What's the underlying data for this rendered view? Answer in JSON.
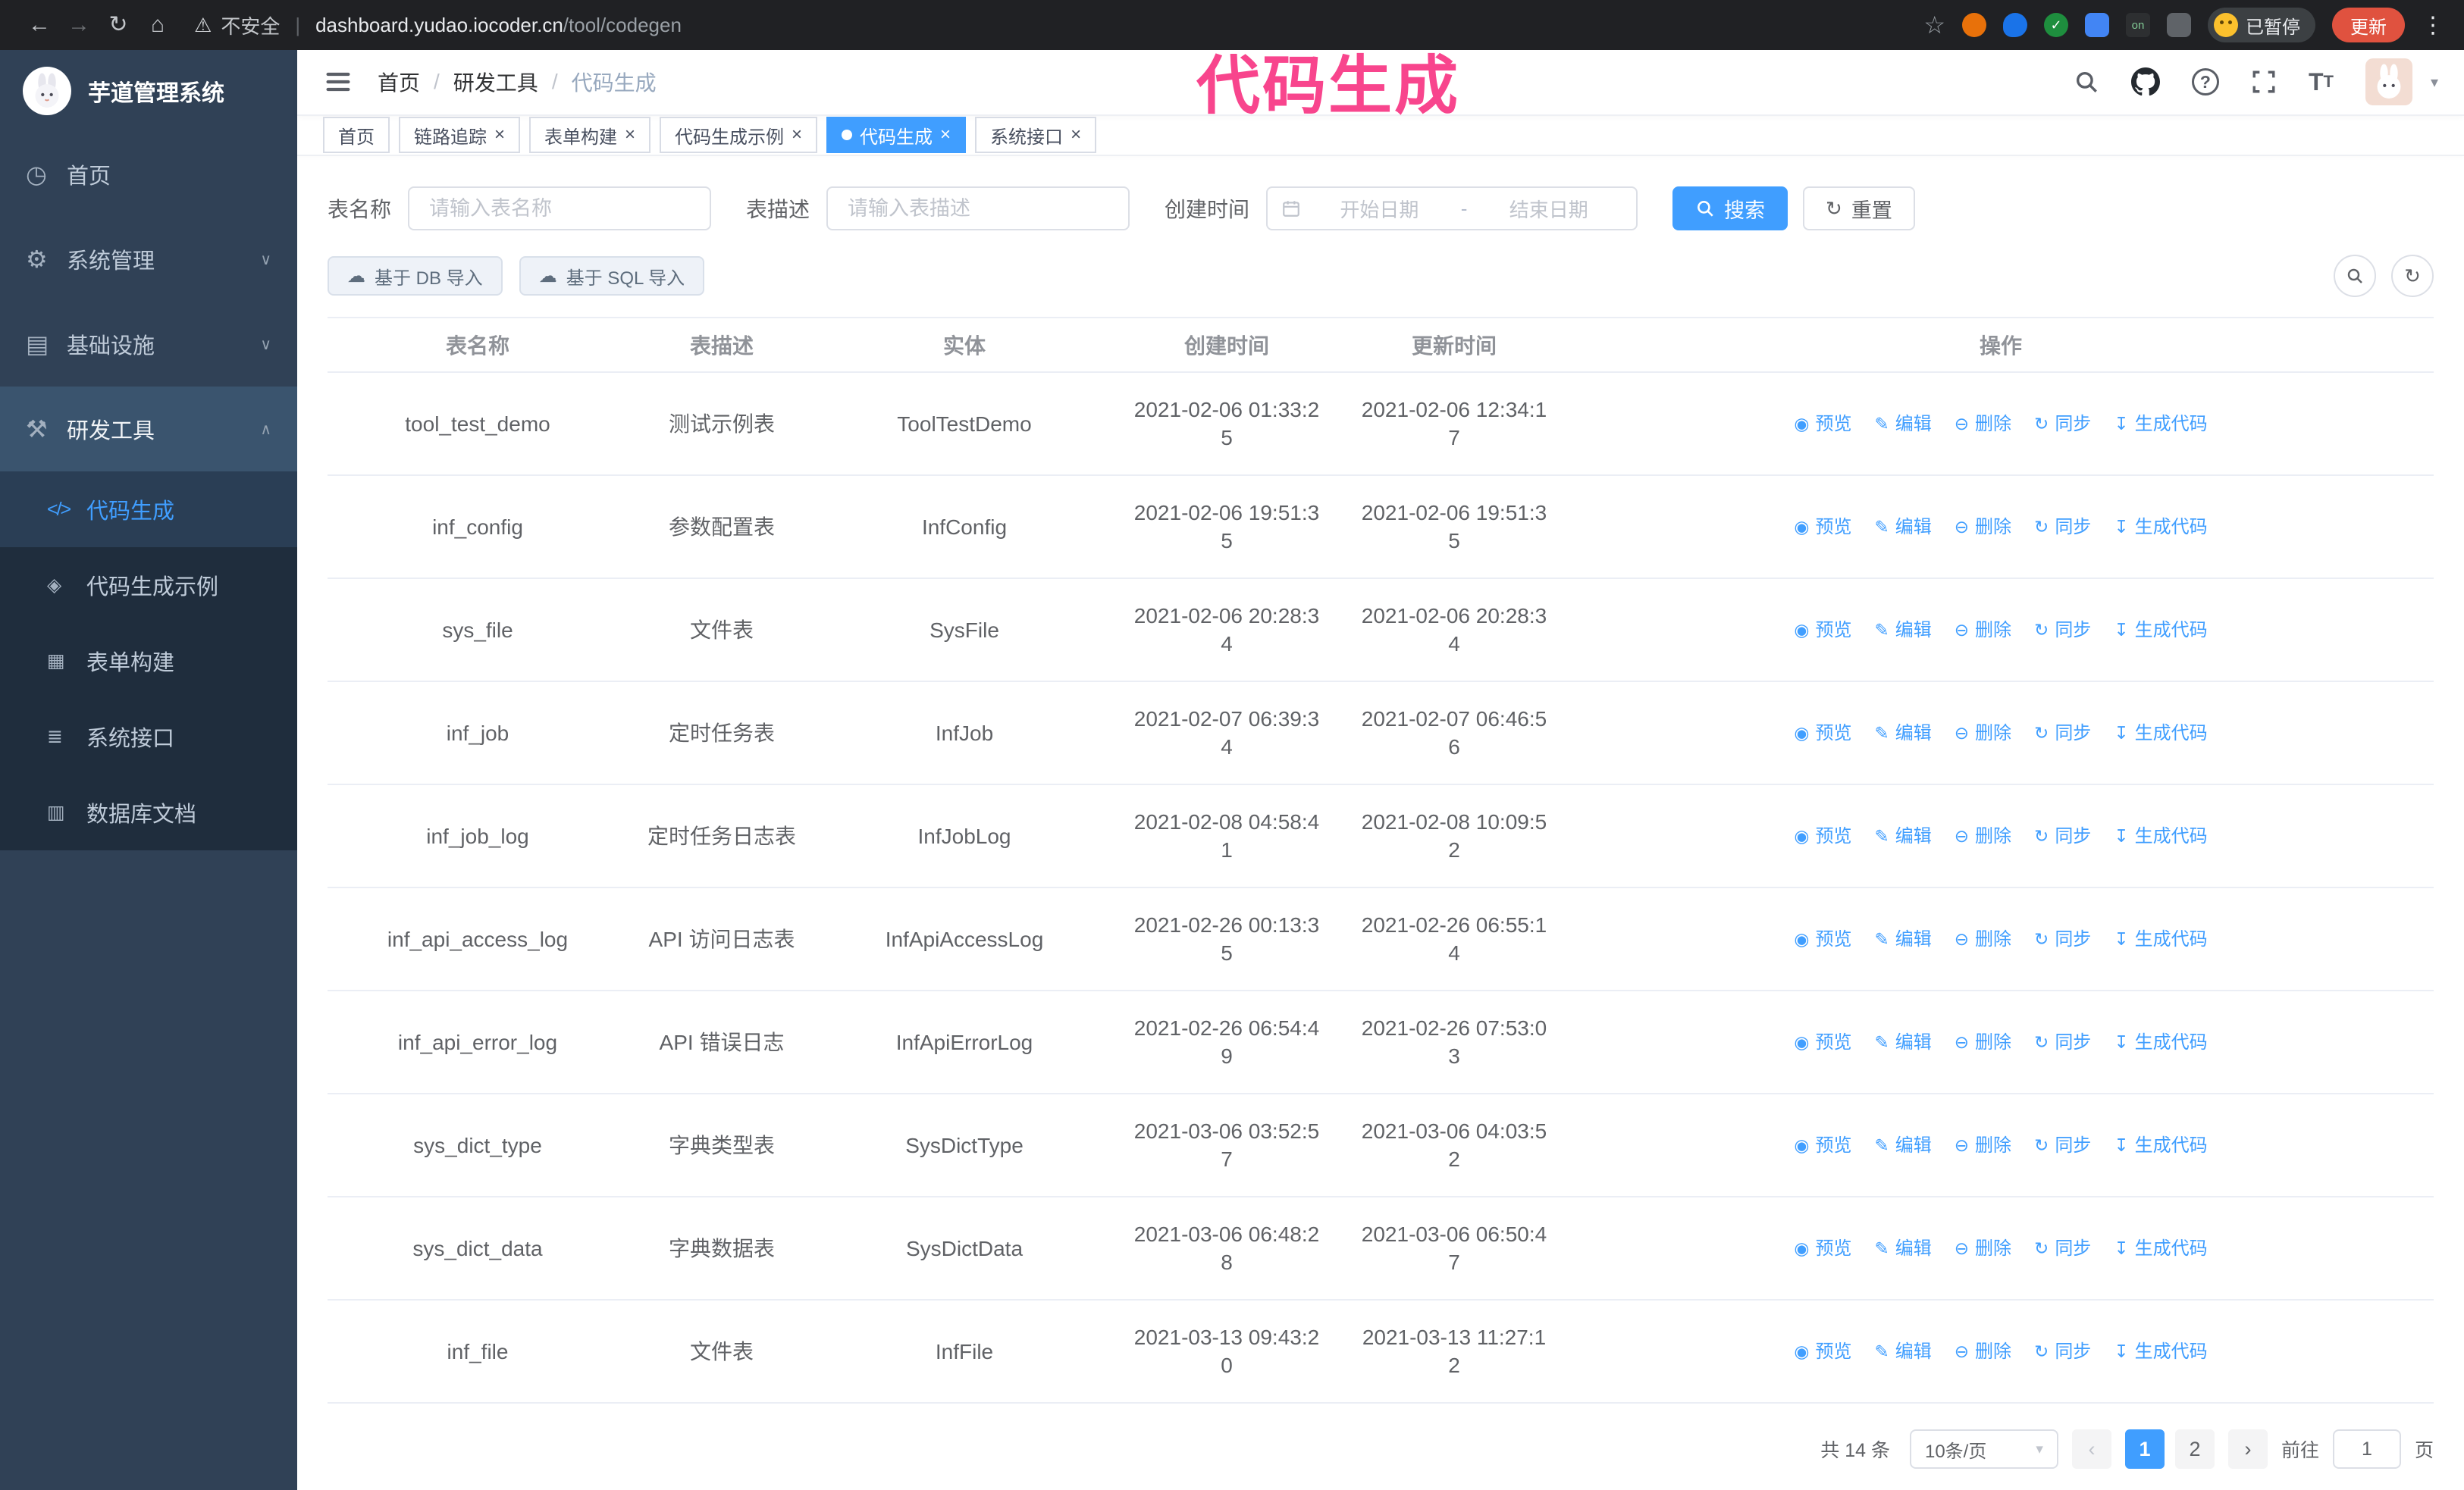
{
  "colors": {
    "accent": "#409EFF",
    "annotation": "#F8458D",
    "sidebar_bg": "#304156",
    "submenu_bg": "#1F2D3D",
    "chrome_bg": "#202124",
    "update_button": "#E0523F"
  },
  "annotation": {
    "text": "代码生成"
  },
  "browser": {
    "security_label": "不安全",
    "url_host": "dashboard.yudao.iocoder.cn",
    "url_path": "/tool/codegen",
    "paused_label": "已暂停",
    "update_label": "更新",
    "on_badge": "on"
  },
  "sidebar": {
    "title": "芋道管理系统",
    "menu": [
      {
        "name": "sidebar-item-home",
        "icon": "dashboard-icon",
        "label": "首页"
      },
      {
        "name": "sidebar-item-system-management",
        "icon": "gear-icon",
        "label": "系统管理",
        "chevron": "down"
      },
      {
        "name": "sidebar-item-infrastructure",
        "icon": "infrastructure-icon",
        "label": "基础设施",
        "chevron": "down"
      },
      {
        "name": "sidebar-item-dev-tools",
        "icon": "tools-icon",
        "label": "研发工具",
        "chevron": "up",
        "open": true
      }
    ],
    "submenu": [
      {
        "name": "sidebar-subitem-codegen",
        "icon": "code-icon",
        "label": "代码生成",
        "active": true
      },
      {
        "name": "sidebar-subitem-codegen-example",
        "icon": "badge-icon",
        "label": "代码生成示例"
      },
      {
        "name": "sidebar-subitem-form-builder",
        "icon": "form-icon",
        "label": "表单构建"
      },
      {
        "name": "sidebar-subitem-system-api",
        "icon": "api-icon",
        "label": "系统接口"
      },
      {
        "name": "sidebar-subitem-database-doc",
        "icon": "database-icon",
        "label": "数据库文档"
      }
    ]
  },
  "header": {
    "breadcrumb": [
      "首页",
      "研发工具",
      "代码生成"
    ]
  },
  "tabs": [
    {
      "name": "tab-home",
      "label": "首页",
      "closable": false
    },
    {
      "name": "tab-link-tracing",
      "label": "链路追踪",
      "closable": true
    },
    {
      "name": "tab-form-builder",
      "label": "表单构建",
      "closable": true
    },
    {
      "name": "tab-codegen-example",
      "label": "代码生成示例",
      "closable": true
    },
    {
      "name": "tab-codegen",
      "label": "代码生成",
      "closable": true,
      "active": true
    },
    {
      "name": "tab-system-api",
      "label": "系统接口",
      "closable": true
    }
  ],
  "filters": {
    "table_name_label": "表名称",
    "table_name_placeholder": "请输入表名称",
    "table_desc_label": "表描述",
    "table_desc_placeholder": "请输入表描述",
    "create_time_label": "创建时间",
    "start_placeholder": "开始日期",
    "range_separator": "-",
    "end_placeholder": "结束日期",
    "search_label": "搜索",
    "reset_label": "重置"
  },
  "toolbar": {
    "import_db_label": "基于 DB 导入",
    "import_sql_label": "基于 SQL 导入"
  },
  "table": {
    "columns": [
      "表名称",
      "表描述",
      "实体",
      "创建时间",
      "更新时间",
      "操作"
    ],
    "actions": [
      {
        "name": "action-preview",
        "icon": "eye-icon",
        "label": "预览"
      },
      {
        "name": "action-edit",
        "icon": "edit-icon",
        "label": "编辑"
      },
      {
        "name": "action-delete",
        "icon": "delete-icon",
        "label": "删除"
      },
      {
        "name": "action-sync",
        "icon": "sync-icon",
        "label": "同步"
      },
      {
        "name": "action-generate",
        "icon": "download-icon",
        "label": "生成代码"
      }
    ],
    "rows": [
      {
        "name": "tool_test_demo",
        "desc": "测试示例表",
        "entity": "ToolTestDemo",
        "created": "2021-02-06 01:33:25",
        "updated": "2021-02-06 12:34:17"
      },
      {
        "name": "inf_config",
        "desc": "参数配置表",
        "entity": "InfConfig",
        "created": "2021-02-06 19:51:35",
        "updated": "2021-02-06 19:51:35"
      },
      {
        "name": "sys_file",
        "desc": "文件表",
        "entity": "SysFile",
        "created": "2021-02-06 20:28:34",
        "updated": "2021-02-06 20:28:34"
      },
      {
        "name": "inf_job",
        "desc": "定时任务表",
        "entity": "InfJob",
        "created": "2021-02-07 06:39:34",
        "updated": "2021-02-07 06:46:56"
      },
      {
        "name": "inf_job_log",
        "desc": "定时任务日志表",
        "entity": "InfJobLog",
        "created": "2021-02-08 04:58:41",
        "updated": "2021-02-08 10:09:52"
      },
      {
        "name": "inf_api_access_log",
        "desc": "API 访问日志表",
        "entity": "InfApiAccessLog",
        "created": "2021-02-26 00:13:35",
        "updated": "2021-02-26 06:55:14"
      },
      {
        "name": "inf_api_error_log",
        "desc": "API 错误日志",
        "entity": "InfApiErrorLog",
        "created": "2021-02-26 06:54:49",
        "updated": "2021-02-26 07:53:03"
      },
      {
        "name": "sys_dict_type",
        "desc": "字典类型表",
        "entity": "SysDictType",
        "created": "2021-03-06 03:52:57",
        "updated": "2021-03-06 04:03:52"
      },
      {
        "name": "sys_dict_data",
        "desc": "字典数据表",
        "entity": "SysDictData",
        "created": "2021-03-06 06:48:28",
        "updated": "2021-03-06 06:50:47"
      },
      {
        "name": "inf_file",
        "desc": "文件表",
        "entity": "InfFile",
        "created": "2021-03-13 09:43:20",
        "updated": "2021-03-13 11:27:12"
      }
    ]
  },
  "pagination": {
    "total": "共 14 条",
    "page_size": "10条/页",
    "pages": [
      "1",
      "2"
    ],
    "active_page": "1",
    "goto_label": "前往",
    "goto_value": "1",
    "goto_unit": "页"
  }
}
